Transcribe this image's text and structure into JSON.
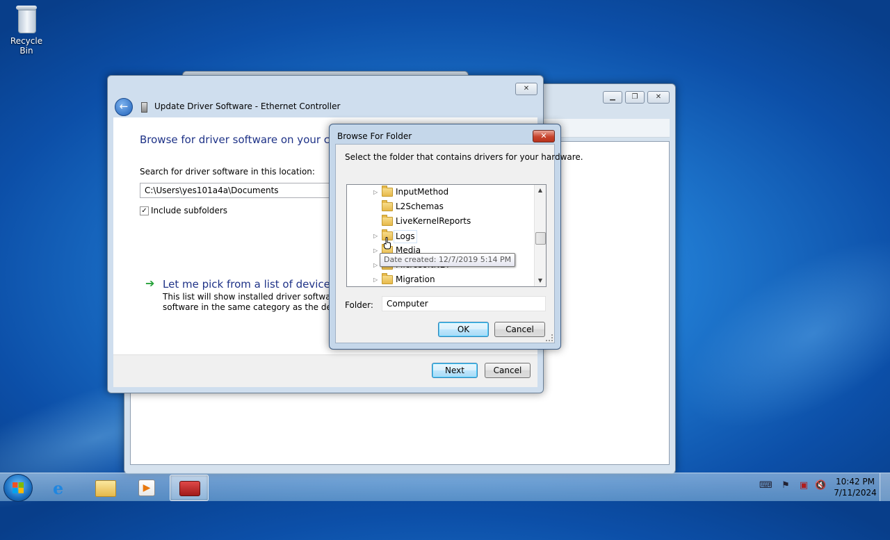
{
  "desktop": {
    "recycle_bin_label": "Recycle Bin"
  },
  "background_window": {
    "minimize_icon": "minimize-icon",
    "maximize_icon": "maximize-icon",
    "close_icon": "close-icon"
  },
  "wizard": {
    "title": "Update Driver Software - Ethernet Controller",
    "heading": "Browse for driver software on your com",
    "search_label": "Search for driver software in this location:",
    "path_value": "C:\\Users\\yes101a4a\\Documents",
    "include_subfolders_label": "Include subfolders",
    "include_subfolders_checked": true,
    "pick_link": "Let me pick from a list of device dri",
    "pick_desc_line1": "This list will show installed driver software com",
    "pick_desc_line2": "software in the same category as the device.",
    "next_label": "Next",
    "cancel_label": "Cancel"
  },
  "browse_dialog": {
    "title": "Browse For Folder",
    "instruction": "Select the folder that contains drivers for your hardware.",
    "tree_items": [
      {
        "label": "InputMethod",
        "expandable": true
      },
      {
        "label": "L2Schemas",
        "expandable": false
      },
      {
        "label": "LiveKernelReports",
        "expandable": false
      },
      {
        "label": "Logs",
        "expandable": true
      },
      {
        "label": "Media",
        "expandable": true
      },
      {
        "label": "MicrosoftNET",
        "expandable": true
      },
      {
        "label": "Migration",
        "expandable": true
      }
    ],
    "tooltip": "Date created: 12/7/2019 5:14 PM",
    "folder_label": "Folder:",
    "folder_value": "Computer",
    "ok_label": "OK",
    "cancel_label": "Cancel"
  },
  "taskbar": {
    "time": "10:42 PM",
    "date": "7/11/2024"
  }
}
